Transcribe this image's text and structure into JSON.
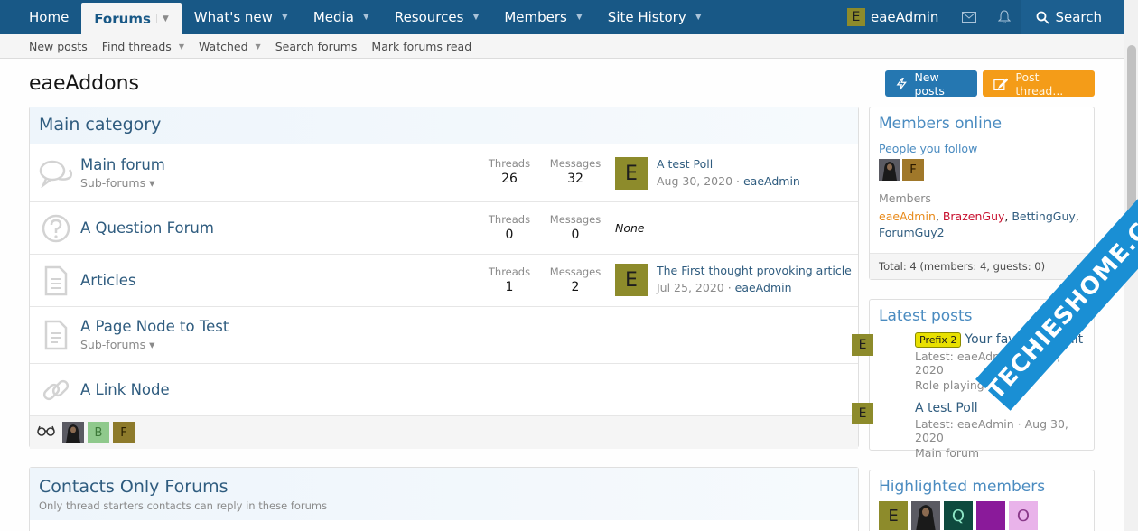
{
  "nav": {
    "tabs": [
      {
        "label": "Home",
        "active": false,
        "caret": false
      },
      {
        "label": "Forums",
        "active": true,
        "caret": true
      },
      {
        "label": "What's new",
        "active": false,
        "caret": true
      },
      {
        "label": "Media",
        "active": false,
        "caret": true
      },
      {
        "label": "Resources",
        "active": false,
        "caret": true
      },
      {
        "label": "Members",
        "active": false,
        "caret": true
      },
      {
        "label": "Site History",
        "active": false,
        "caret": true
      }
    ],
    "user_initial": "E",
    "username": "eaeAdmin",
    "search_label": "Search",
    "icons": [
      "envelope-icon",
      "bell-icon",
      "search-icon"
    ]
  },
  "subnav": {
    "items": [
      {
        "label": "New posts",
        "caret": false
      },
      {
        "label": "Find threads",
        "caret": true
      },
      {
        "label": "Watched",
        "caret": true
      },
      {
        "label": "Search forums",
        "caret": false
      },
      {
        "label": "Mark forums read",
        "caret": false
      }
    ]
  },
  "page": {
    "title": "eaeAddons",
    "new_posts_label": "New posts",
    "post_thread_label": "Post thread..."
  },
  "main_category": {
    "title": "Main category",
    "nodes": [
      {
        "title": "Main forum",
        "sub": "Sub-forums ▾",
        "icon": "chat-bubbles-icon",
        "threads_label": "Threads",
        "threads": "26",
        "messages_label": "Messages",
        "messages": "32",
        "last_initial": "E",
        "last_title": "A test Poll",
        "last_date": "Aug 30, 2020 · ",
        "last_user": "eaeAdmin"
      },
      {
        "title": "A Question Forum",
        "sub": "",
        "icon": "question-icon",
        "threads_label": "Threads",
        "threads": "0",
        "messages_label": "Messages",
        "messages": "0",
        "none": "None"
      },
      {
        "title": "Articles",
        "sub": "",
        "icon": "document-icon",
        "threads_label": "Threads",
        "threads": "1",
        "messages_label": "Messages",
        "messages": "2",
        "last_initial": "E",
        "last_title": "The First thought provoking article",
        "last_date": "Jul 25, 2020 · ",
        "last_user": "eaeAdmin"
      },
      {
        "title": "A Page Node to Test",
        "sub": "Sub-forums ▾",
        "icon": "page-icon"
      },
      {
        "title": "A Link Node",
        "sub": "",
        "icon": "link-icon"
      }
    ],
    "viewers": [
      "B",
      "F"
    ]
  },
  "contacts": {
    "title": "Contacts Only Forums",
    "description": "Only thread starters contacts can reply in these forums"
  },
  "sidebar": {
    "members_online": {
      "title": "Members online",
      "people_follow": "People you follow",
      "follow_initial": "F",
      "members_label": "Members",
      "members": [
        {
          "name": "eaeAdmin",
          "color": "#e88a1a"
        },
        {
          "name": "BrazenGuy",
          "color": "#c8102e"
        },
        {
          "name": "BettingGuy",
          "color": "#2f5c7f"
        },
        {
          "name": "ForumGuy2",
          "color": "#2f5c7f"
        }
      ],
      "total": "Total: 4 (members: 4, guests: 0)"
    },
    "latest_posts": {
      "title": "Latest posts",
      "items": [
        {
          "initial": "E",
          "prefix": "Prefix 2",
          "title": "Your favourite fruit",
          "meta": "Latest: eaeAdmin · Sep 1, 2020",
          "forum": "Role playing forums"
        },
        {
          "initial": "E",
          "prefix": "",
          "title": "A test Poll",
          "meta": "Latest: eaeAdmin · Aug 30, 2020",
          "forum": "Main forum"
        }
      ]
    },
    "highlighted": {
      "title": "Highlighted members",
      "avatars": [
        "E",
        "",
        "Q",
        "",
        "O"
      ]
    }
  },
  "watermark": "TECHIESHOME.COM",
  "colors": {
    "nav_bg": "#185886",
    "accent": "#2577b1",
    "orange": "#f49c18",
    "avatar_e": "#8d8b2b",
    "link": "#2f5c7f"
  }
}
